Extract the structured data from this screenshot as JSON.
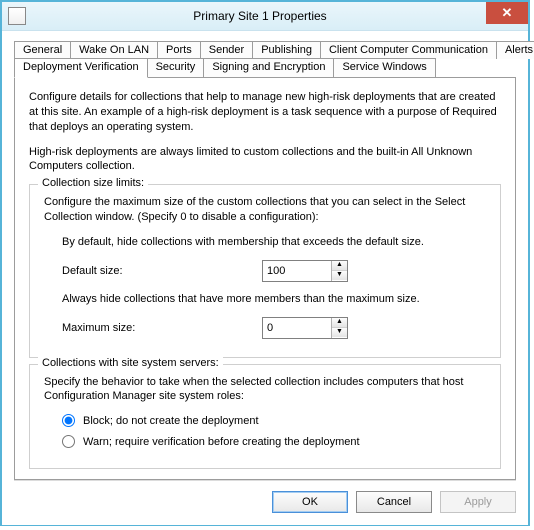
{
  "window": {
    "title": "Primary Site 1 Properties"
  },
  "tabs": {
    "row1": [
      "General",
      "Wake On LAN",
      "Ports",
      "Sender",
      "Publishing",
      "Client Computer Communication",
      "Alerts"
    ],
    "row2": [
      "Deployment Verification",
      "Security",
      "Signing and Encryption",
      "Service Windows"
    ],
    "active": "Deployment Verification"
  },
  "body": {
    "desc1": "Configure details for collections that help to manage new high-risk deployments that are created at this site. An example of a high-risk deployment is a task sequence with a purpose of Required that deploys an operating system.",
    "desc2": "High-risk deployments are always limited to custom collections and the built-in All Unknown Computers collection."
  },
  "group1": {
    "legend": "Collection size limits:",
    "desc": "Configure the maximum size of the custom collections that you can select in the Select Collection window. (Specify 0 to disable a configuration):",
    "hide_default": "By default, hide collections with membership that exceeds the default size.",
    "default_label": "Default size:",
    "default_value": "100",
    "hide_max": "Always hide collections that have more members than the maximum size.",
    "max_label": "Maximum size:",
    "max_value": "0"
  },
  "group2": {
    "legend": "Collections with site system servers:",
    "desc": "Specify the behavior to take when the selected collection includes computers that host Configuration Manager site system roles:",
    "opt_block": "Block; do not create the deployment",
    "opt_warn": "Warn; require verification before creating the deployment"
  },
  "buttons": {
    "ok": "OK",
    "cancel": "Cancel",
    "apply": "Apply"
  }
}
